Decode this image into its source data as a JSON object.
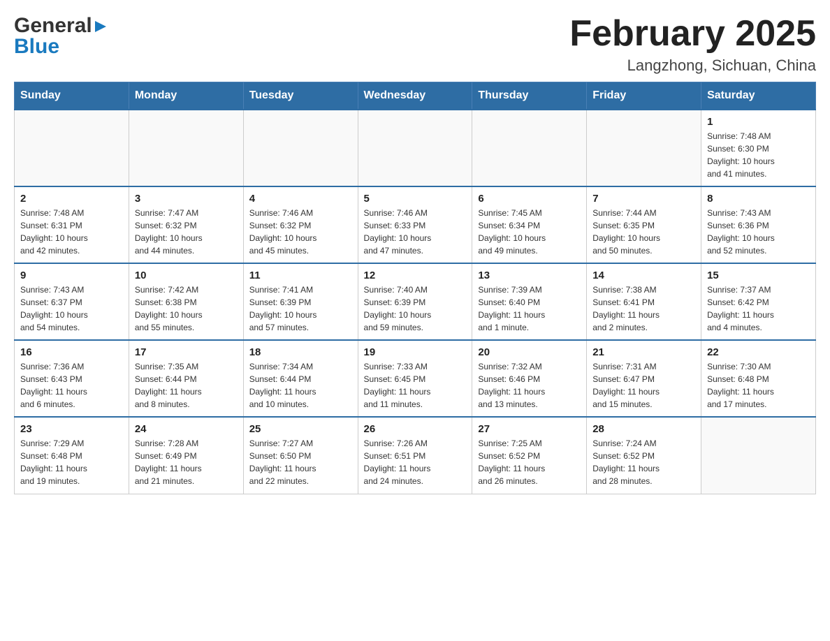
{
  "logo": {
    "general": "General",
    "blue": "Blue"
  },
  "title": "February 2025",
  "location": "Langzhong, Sichuan, China",
  "days_of_week": [
    "Sunday",
    "Monday",
    "Tuesday",
    "Wednesday",
    "Thursday",
    "Friday",
    "Saturday"
  ],
  "weeks": [
    [
      {
        "day": "",
        "info": ""
      },
      {
        "day": "",
        "info": ""
      },
      {
        "day": "",
        "info": ""
      },
      {
        "day": "",
        "info": ""
      },
      {
        "day": "",
        "info": ""
      },
      {
        "day": "",
        "info": ""
      },
      {
        "day": "1",
        "info": "Sunrise: 7:48 AM\nSunset: 6:30 PM\nDaylight: 10 hours\nand 41 minutes."
      }
    ],
    [
      {
        "day": "2",
        "info": "Sunrise: 7:48 AM\nSunset: 6:31 PM\nDaylight: 10 hours\nand 42 minutes."
      },
      {
        "day": "3",
        "info": "Sunrise: 7:47 AM\nSunset: 6:32 PM\nDaylight: 10 hours\nand 44 minutes."
      },
      {
        "day": "4",
        "info": "Sunrise: 7:46 AM\nSunset: 6:32 PM\nDaylight: 10 hours\nand 45 minutes."
      },
      {
        "day": "5",
        "info": "Sunrise: 7:46 AM\nSunset: 6:33 PM\nDaylight: 10 hours\nand 47 minutes."
      },
      {
        "day": "6",
        "info": "Sunrise: 7:45 AM\nSunset: 6:34 PM\nDaylight: 10 hours\nand 49 minutes."
      },
      {
        "day": "7",
        "info": "Sunrise: 7:44 AM\nSunset: 6:35 PM\nDaylight: 10 hours\nand 50 minutes."
      },
      {
        "day": "8",
        "info": "Sunrise: 7:43 AM\nSunset: 6:36 PM\nDaylight: 10 hours\nand 52 minutes."
      }
    ],
    [
      {
        "day": "9",
        "info": "Sunrise: 7:43 AM\nSunset: 6:37 PM\nDaylight: 10 hours\nand 54 minutes."
      },
      {
        "day": "10",
        "info": "Sunrise: 7:42 AM\nSunset: 6:38 PM\nDaylight: 10 hours\nand 55 minutes."
      },
      {
        "day": "11",
        "info": "Sunrise: 7:41 AM\nSunset: 6:39 PM\nDaylight: 10 hours\nand 57 minutes."
      },
      {
        "day": "12",
        "info": "Sunrise: 7:40 AM\nSunset: 6:39 PM\nDaylight: 10 hours\nand 59 minutes."
      },
      {
        "day": "13",
        "info": "Sunrise: 7:39 AM\nSunset: 6:40 PM\nDaylight: 11 hours\nand 1 minute."
      },
      {
        "day": "14",
        "info": "Sunrise: 7:38 AM\nSunset: 6:41 PM\nDaylight: 11 hours\nand 2 minutes."
      },
      {
        "day": "15",
        "info": "Sunrise: 7:37 AM\nSunset: 6:42 PM\nDaylight: 11 hours\nand 4 minutes."
      }
    ],
    [
      {
        "day": "16",
        "info": "Sunrise: 7:36 AM\nSunset: 6:43 PM\nDaylight: 11 hours\nand 6 minutes."
      },
      {
        "day": "17",
        "info": "Sunrise: 7:35 AM\nSunset: 6:44 PM\nDaylight: 11 hours\nand 8 minutes."
      },
      {
        "day": "18",
        "info": "Sunrise: 7:34 AM\nSunset: 6:44 PM\nDaylight: 11 hours\nand 10 minutes."
      },
      {
        "day": "19",
        "info": "Sunrise: 7:33 AM\nSunset: 6:45 PM\nDaylight: 11 hours\nand 11 minutes."
      },
      {
        "day": "20",
        "info": "Sunrise: 7:32 AM\nSunset: 6:46 PM\nDaylight: 11 hours\nand 13 minutes."
      },
      {
        "day": "21",
        "info": "Sunrise: 7:31 AM\nSunset: 6:47 PM\nDaylight: 11 hours\nand 15 minutes."
      },
      {
        "day": "22",
        "info": "Sunrise: 7:30 AM\nSunset: 6:48 PM\nDaylight: 11 hours\nand 17 minutes."
      }
    ],
    [
      {
        "day": "23",
        "info": "Sunrise: 7:29 AM\nSunset: 6:48 PM\nDaylight: 11 hours\nand 19 minutes."
      },
      {
        "day": "24",
        "info": "Sunrise: 7:28 AM\nSunset: 6:49 PM\nDaylight: 11 hours\nand 21 minutes."
      },
      {
        "day": "25",
        "info": "Sunrise: 7:27 AM\nSunset: 6:50 PM\nDaylight: 11 hours\nand 22 minutes."
      },
      {
        "day": "26",
        "info": "Sunrise: 7:26 AM\nSunset: 6:51 PM\nDaylight: 11 hours\nand 24 minutes."
      },
      {
        "day": "27",
        "info": "Sunrise: 7:25 AM\nSunset: 6:52 PM\nDaylight: 11 hours\nand 26 minutes."
      },
      {
        "day": "28",
        "info": "Sunrise: 7:24 AM\nSunset: 6:52 PM\nDaylight: 11 hours\nand 28 minutes."
      },
      {
        "day": "",
        "info": ""
      }
    ]
  ]
}
